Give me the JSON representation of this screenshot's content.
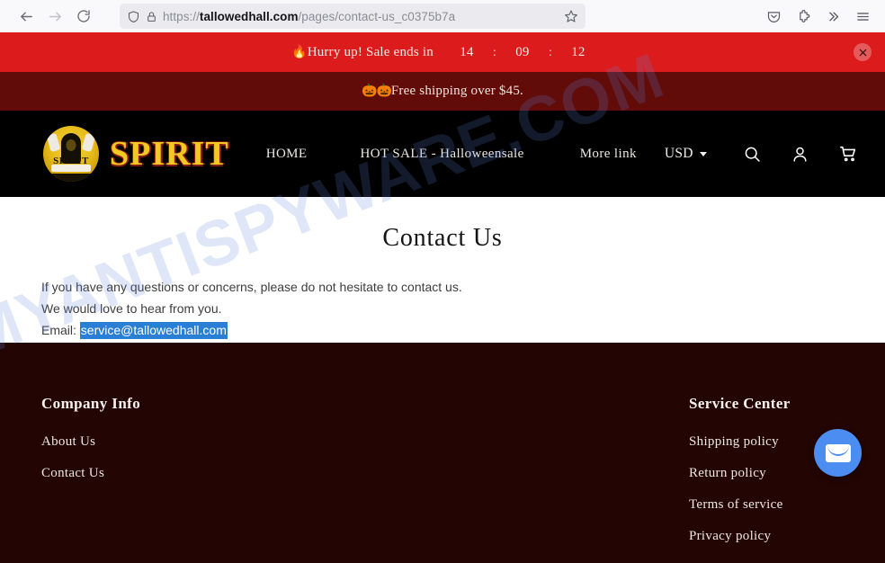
{
  "browser": {
    "back_label": "back-arrow",
    "forward_label": "forward-arrow",
    "reload_label": "reload",
    "url_prefix": "https://",
    "url_domain": "tallowedhall.com",
    "url_path": "/pages/contact-us_c0375b7a",
    "url_full": "https://tallowedhall.com/pages/contact-us_c0375b7a",
    "icons": {
      "shield": "shield-icon",
      "lock": "lock-icon",
      "bookmark": "star-icon",
      "pocket": "pocket-icon",
      "extensions": "extensions-icon",
      "overflow": "double-chevron-icon",
      "menu": "hamburger-menu-icon"
    }
  },
  "promo_top": {
    "flame": "🔥",
    "text": "Hurry up! Sale ends in",
    "hours": "14",
    "sep1": ":",
    "minutes": "09",
    "sep2": ":",
    "seconds": "12",
    "close": "✕",
    "bg": "#dc1c1c"
  },
  "promo_second": {
    "pumpkins": "🎃🎃",
    "text": "Free shipping over $45.",
    "bg": "#620c0a"
  },
  "header": {
    "logo_badge_text": "SPIRIT",
    "logo_text": "SPIRIT",
    "nav": [
      {
        "label": "HOME"
      },
      {
        "label": "HOT SALE - Halloweensale"
      },
      {
        "label": "More link"
      }
    ],
    "currency": "USD",
    "icons": {
      "search": "search-icon",
      "account": "account-icon",
      "cart": "cart-icon"
    },
    "bg": "#000000"
  },
  "main": {
    "title": "Contact Us",
    "line1": "If you have any questions or concerns, please do not hesitate to contact us.",
    "line2": "We would love to hear from you.",
    "email_label": "Email:",
    "email": "service@tallowedhall.com",
    "selection_color": "#2a7fd4"
  },
  "footer": {
    "bg": "#230503",
    "columns": [
      {
        "heading": "Company Info",
        "links": [
          {
            "label": "About Us"
          },
          {
            "label": "Contact Us"
          }
        ]
      },
      {
        "heading": "Service Center",
        "links": [
          {
            "label": "Shipping policy"
          },
          {
            "label": "Return policy"
          },
          {
            "label": "Terms of service"
          },
          {
            "label": "Privacy policy"
          }
        ]
      }
    ]
  },
  "chat": {
    "icon": "envelope-icon",
    "color": "#4b8df0"
  },
  "watermark": {
    "text": "MYANTISPYWARE.COM"
  }
}
